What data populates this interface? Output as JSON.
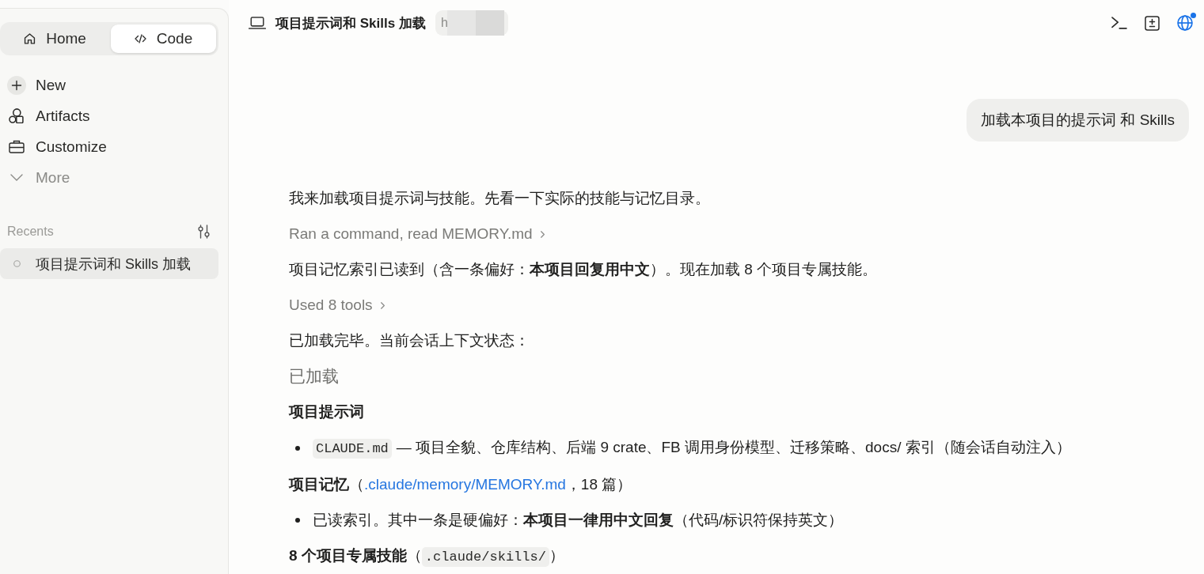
{
  "sidebar": {
    "mode_tabs": [
      {
        "label": "Home",
        "selected": false
      },
      {
        "label": "Code",
        "selected": true
      }
    ],
    "nav_items": [
      {
        "kind": "new",
        "label": "New"
      },
      {
        "kind": "link",
        "label": "Artifacts"
      },
      {
        "kind": "link",
        "label": "Customize"
      },
      {
        "kind": "expander",
        "label": "More"
      }
    ],
    "recents": {
      "title": "Recents",
      "items": [
        {
          "label": "项目提示词和 Skills 加载",
          "selected": true
        }
      ]
    }
  },
  "header": {
    "title": "项目提示词和 Skills 加载",
    "chip": "h",
    "notification_dot": true
  },
  "conversation": {
    "user_message": "加载本项目的提示词 和 Skills",
    "blocks": [
      {
        "kind": "paragraph",
        "parts": [
          {
            "kind": "text",
            "text": "我来加载项目提示词与技能。先看一下实际的技能与记忆目录。"
          }
        ]
      },
      {
        "kind": "tool_summary",
        "text": "Ran a command, read MEMORY.md"
      },
      {
        "kind": "paragraph",
        "parts": [
          {
            "kind": "text",
            "text": "项目记忆索引已读到（含一条偏好：**本项目回复用中文**）。现在加载 8 个项目专属技能。"
          }
        ]
      },
      {
        "kind": "tool_summary",
        "text": "Used 8 tools"
      },
      {
        "kind": "paragraph",
        "parts": [
          {
            "kind": "text",
            "text": "已加载完毕。当前会话上下文状态："
          }
        ]
      },
      {
        "kind": "heading",
        "text": "已加载"
      },
      {
        "kind": "subheading",
        "title": "项目提示词"
      },
      {
        "kind": "bullet",
        "parts": [
          {
            "kind": "code",
            "text": "CLAUDE.md"
          },
          {
            "kind": "text",
            "text": "— 项目全貌、仓库结构、后端 9 crate、FB 调用身份模型、迁移策略、docs/ 索引（随会话自动注入）"
          }
        ]
      },
      {
        "kind": "subheading",
        "title": "项目记忆",
        "parts": [
          {
            "kind": "text",
            "text": "（"
          },
          {
            "kind": "link",
            "text": ".claude/memory/MEMORY.md"
          },
          {
            "kind": "text",
            "text": "，18 篇）"
          }
        ]
      },
      {
        "kind": "bullet",
        "parts": [
          {
            "kind": "text",
            "text": "已读索引。其中一条是硬偏好：**本项目一律用中文回复**（代码/标识符保持英文）"
          }
        ]
      },
      {
        "kind": "subheading",
        "title": "8 个项目专属技能",
        "parts": [
          {
            "kind": "text",
            "text": "（"
          },
          {
            "kind": "code",
            "text": ".claude/skills/"
          },
          {
            "kind": "text",
            "text": "）"
          }
        ]
      }
    ]
  }
}
